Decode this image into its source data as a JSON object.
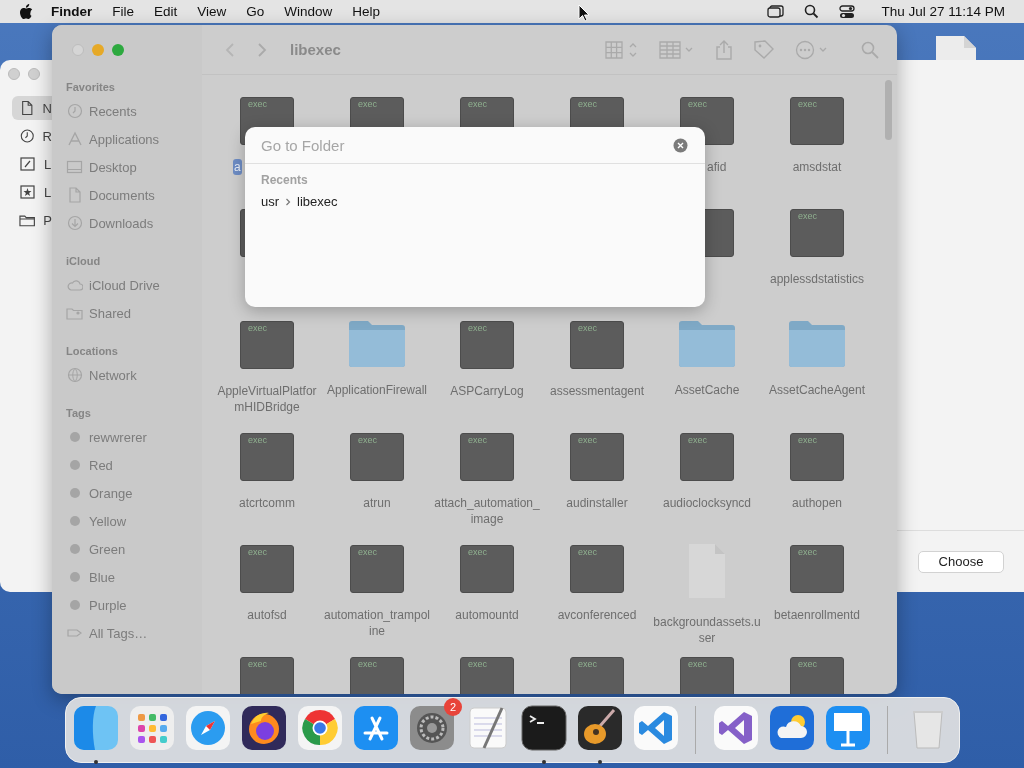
{
  "menu_bar": {
    "app_name": "Finder",
    "menus": [
      "File",
      "Edit",
      "View",
      "Go",
      "Window",
      "Help"
    ],
    "clock": "Thu Jul 27  11:14 PM"
  },
  "back_window": {
    "sidebar_items": [
      {
        "label": "N",
        "kind": "doc",
        "selected": true
      },
      {
        "label": "R",
        "kind": "clock",
        "selected": false
      },
      {
        "label": "L",
        "kind": "chart",
        "selected": false
      },
      {
        "label": "L",
        "kind": "star",
        "selected": false
      },
      {
        "label": "P",
        "kind": "folder",
        "selected": false
      }
    ],
    "button": "Choose"
  },
  "finder": {
    "title": "libexec",
    "sidebar": [
      {
        "title": "Favorites",
        "items": [
          {
            "label": "Recents",
            "kind": "clock"
          },
          {
            "label": "Applications",
            "kind": "apps"
          },
          {
            "label": "Desktop",
            "kind": "desktop"
          },
          {
            "label": "Documents",
            "kind": "doc"
          },
          {
            "label": "Downloads",
            "kind": "download"
          }
        ]
      },
      {
        "title": "iCloud",
        "items": [
          {
            "label": "iCloud Drive",
            "kind": "cloud"
          },
          {
            "label": "Shared",
            "kind": "shared"
          }
        ]
      },
      {
        "title": "Locations",
        "items": [
          {
            "label": "Network",
            "kind": "network"
          }
        ]
      },
      {
        "title": "Tags",
        "items": [
          {
            "label": "rewwrerer",
            "kind": "tag"
          },
          {
            "label": "Red",
            "kind": "tag"
          },
          {
            "label": "Orange",
            "kind": "tag"
          },
          {
            "label": "Yellow",
            "kind": "tag"
          },
          {
            "label": "Green",
            "kind": "tag"
          },
          {
            "label": "Blue",
            "kind": "tag"
          },
          {
            "label": "Purple",
            "kind": "tag"
          },
          {
            "label": "All Tags…",
            "kind": "alltags"
          }
        ]
      }
    ],
    "rows": [
      [
        {
          "kind": "exec",
          "tag": "exec",
          "label": "a",
          "covered_right": true,
          "selected": true
        },
        {
          "kind": "exec",
          "tag": "exec"
        },
        {
          "kind": "exec",
          "tag": "exec"
        },
        {
          "kind": "exec",
          "tag": "exec"
        },
        {
          "kind": "exec",
          "tag": "exec",
          "label": "afid",
          "covered_left": true,
          "selected": false
        },
        {
          "kind": "exec",
          "tag": "exec",
          "label": "amsdstat",
          "selected": false
        }
      ],
      [
        {
          "kind": "exec"
        },
        {
          "kind": "blank"
        },
        {
          "kind": "blank"
        },
        {
          "kind": "blank"
        },
        {
          "kind": "exec"
        },
        {
          "kind": "exec",
          "tag": "exec",
          "label": "applessdstatistics",
          "selected": false
        }
      ],
      [
        {
          "kind": "exec",
          "tag": "exec",
          "label": "AppleVirtualPlatformHIDBridge",
          "selected": false
        },
        {
          "kind": "folder",
          "label": "ApplicationFirewall",
          "selected": false
        },
        {
          "kind": "exec",
          "tag": "exec",
          "label": "ASPCarryLog",
          "selected": false
        },
        {
          "kind": "exec",
          "tag": "exec",
          "label": "assessmentagent",
          "selected": false
        },
        {
          "kind": "folder",
          "label": "AssetCache",
          "selected": false
        },
        {
          "kind": "folder",
          "label": "AssetCacheAgent",
          "selected": false
        }
      ],
      [
        {
          "kind": "exec",
          "tag": "exec",
          "label": "atcrtcomm",
          "selected": false
        },
        {
          "kind": "exec",
          "tag": "exec",
          "label": "atrun",
          "selected": false
        },
        {
          "kind": "exec",
          "tag": "exec",
          "label": "attach_automation_image",
          "selected": false
        },
        {
          "kind": "exec",
          "tag": "exec",
          "label": "audinstaller",
          "selected": false
        },
        {
          "kind": "exec",
          "tag": "exec",
          "label": "audioclocksyncd",
          "selected": false
        },
        {
          "kind": "exec",
          "tag": "exec",
          "label": "authopen",
          "selected": false
        }
      ],
      [
        {
          "kind": "exec",
          "tag": "exec",
          "label": "autofsd",
          "selected": false
        },
        {
          "kind": "exec",
          "tag": "exec",
          "label": "automation_trampoline",
          "selected": false
        },
        {
          "kind": "exec",
          "tag": "exec",
          "label": "automountd",
          "selected": false
        },
        {
          "kind": "exec",
          "tag": "exec",
          "label": "avconferenced",
          "selected": false
        },
        {
          "kind": "document",
          "label": "backgroundassets.user",
          "selected": false
        },
        {
          "kind": "exec",
          "tag": "exec",
          "label": "betaenrollmentd",
          "selected": false
        }
      ],
      [
        {
          "kind": "exec",
          "tag": "exec"
        },
        {
          "kind": "exec",
          "tag": "exec"
        },
        {
          "kind": "exec",
          "tag": "exec"
        },
        {
          "kind": "exec",
          "tag": "exec"
        },
        {
          "kind": "exec",
          "tag": "exec"
        },
        {
          "kind": "exec",
          "tag": "exec"
        }
      ]
    ],
    "go_to_folder": {
      "placeholder": "Go to Folder",
      "section": "Recents",
      "recents": [
        {
          "segments": [
            "usr",
            "libexec"
          ]
        }
      ]
    }
  },
  "dock": {
    "groups": [
      [
        {
          "kind": "finder",
          "running": true
        },
        {
          "kind": "launchpad",
          "running": false
        },
        {
          "kind": "safari",
          "running": false
        },
        {
          "kind": "firefox",
          "running": false
        },
        {
          "kind": "chrome",
          "running": false
        },
        {
          "kind": "appstore",
          "running": false
        },
        {
          "kind": "settings",
          "running": false,
          "badge": "2"
        },
        {
          "kind": "textedit",
          "running": false
        },
        {
          "kind": "terminal",
          "running": true
        },
        {
          "kind": "garageband",
          "running": true
        },
        {
          "kind": "vscode",
          "running": false
        }
      ],
      [
        {
          "kind": "vs",
          "running": false
        },
        {
          "kind": "weather",
          "running": false
        },
        {
          "kind": "keynote",
          "running": false
        }
      ],
      [
        {
          "kind": "trash",
          "running": false
        }
      ]
    ]
  }
}
